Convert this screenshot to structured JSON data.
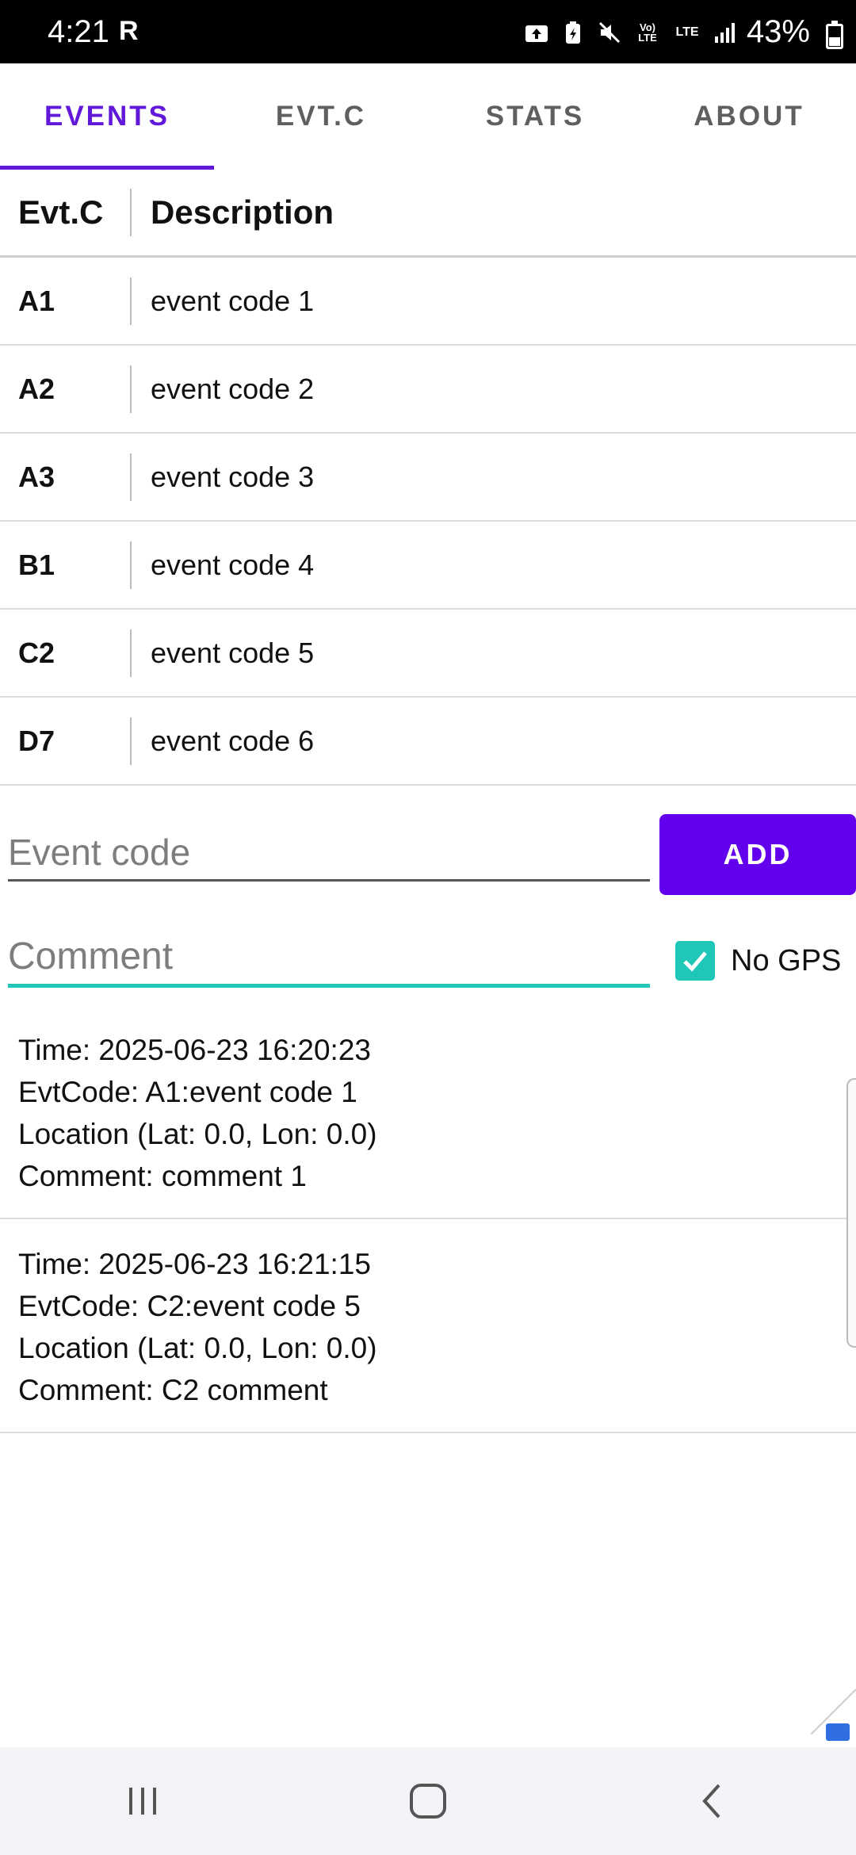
{
  "status_bar": {
    "time": "4:21",
    "carrier": "R",
    "battery_text": "43%",
    "battery_level": 0.43,
    "icons": [
      "upload-icon",
      "battery-saver-icon",
      "mute-icon",
      "volte-icon",
      "lte-icon",
      "signal-icon"
    ],
    "volte_text": "Vo) LTE",
    "lte_text": "LTE"
  },
  "tabs": [
    {
      "label": "EVENTS",
      "active": true
    },
    {
      "label": "EVT.C",
      "active": false
    },
    {
      "label": "STATS",
      "active": false
    },
    {
      "label": "ABOUT",
      "active": false
    }
  ],
  "table": {
    "headers": {
      "code": "Evt.C",
      "description": "Description"
    },
    "rows": [
      {
        "code": "A1",
        "description": "event code 1"
      },
      {
        "code": "A2",
        "description": "event code 2"
      },
      {
        "code": "A3",
        "description": "event code 3"
      },
      {
        "code": "B1",
        "description": "event code 4"
      },
      {
        "code": "C2",
        "description": "event code 5"
      },
      {
        "code": "D7",
        "description": "event code 6"
      }
    ]
  },
  "form": {
    "event_code_placeholder": "Event code",
    "event_code_value": "",
    "add_label": "ADD",
    "comment_placeholder": "Comment",
    "comment_value": "",
    "no_gps_label": "No GPS",
    "no_gps_checked": true
  },
  "log": [
    {
      "time": "Time: 2025-06-23 16:20:23",
      "evtcode": "EvtCode: A1:event code 1",
      "location": "Location (Lat: 0.0, Lon: 0.0)",
      "comment": "Comment: comment 1"
    },
    {
      "time": "Time: 2025-06-23 16:21:15",
      "evtcode": "EvtCode: C2:event code 5",
      "location": "Location (Lat: 0.0, Lon: 0.0)",
      "comment": "Comment: C2 comment"
    }
  ],
  "colors": {
    "accent": "#6218d8",
    "button": "#6200ee",
    "teal": "#1ec7b8"
  },
  "nav": [
    "recent-apps-icon",
    "home-icon",
    "back-icon"
  ]
}
